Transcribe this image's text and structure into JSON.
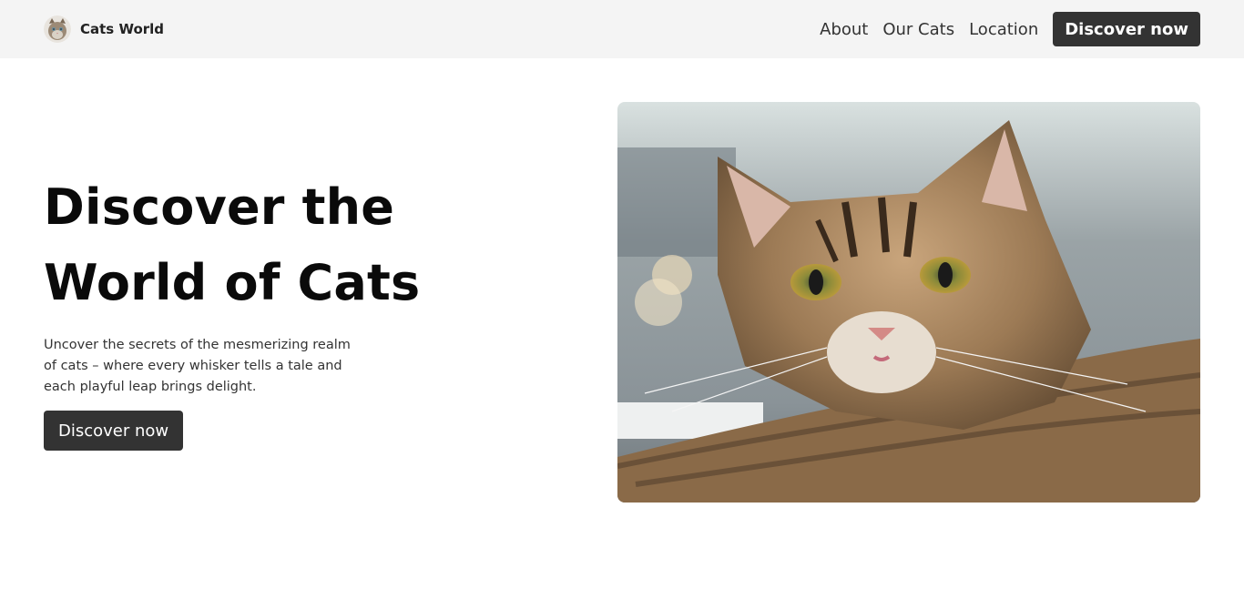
{
  "header": {
    "brand_name": "Cats World",
    "nav_links": [
      "About",
      "Our Cats",
      "Location"
    ],
    "cta_label": "Discover now"
  },
  "hero": {
    "title_line1": "Discover the",
    "title_line2": "World of Cats",
    "subtitle": "Uncover the secrets of the mesmerizing realm of cats – where every whisker tells a tale and each playful leap brings delight.",
    "cta_label": "Discover now",
    "image_icon": "tabby-cat-photo"
  },
  "colors": {
    "navbar_bg": "#f4f4f4",
    "button_bg": "#333333",
    "button_text": "#ffffff"
  }
}
